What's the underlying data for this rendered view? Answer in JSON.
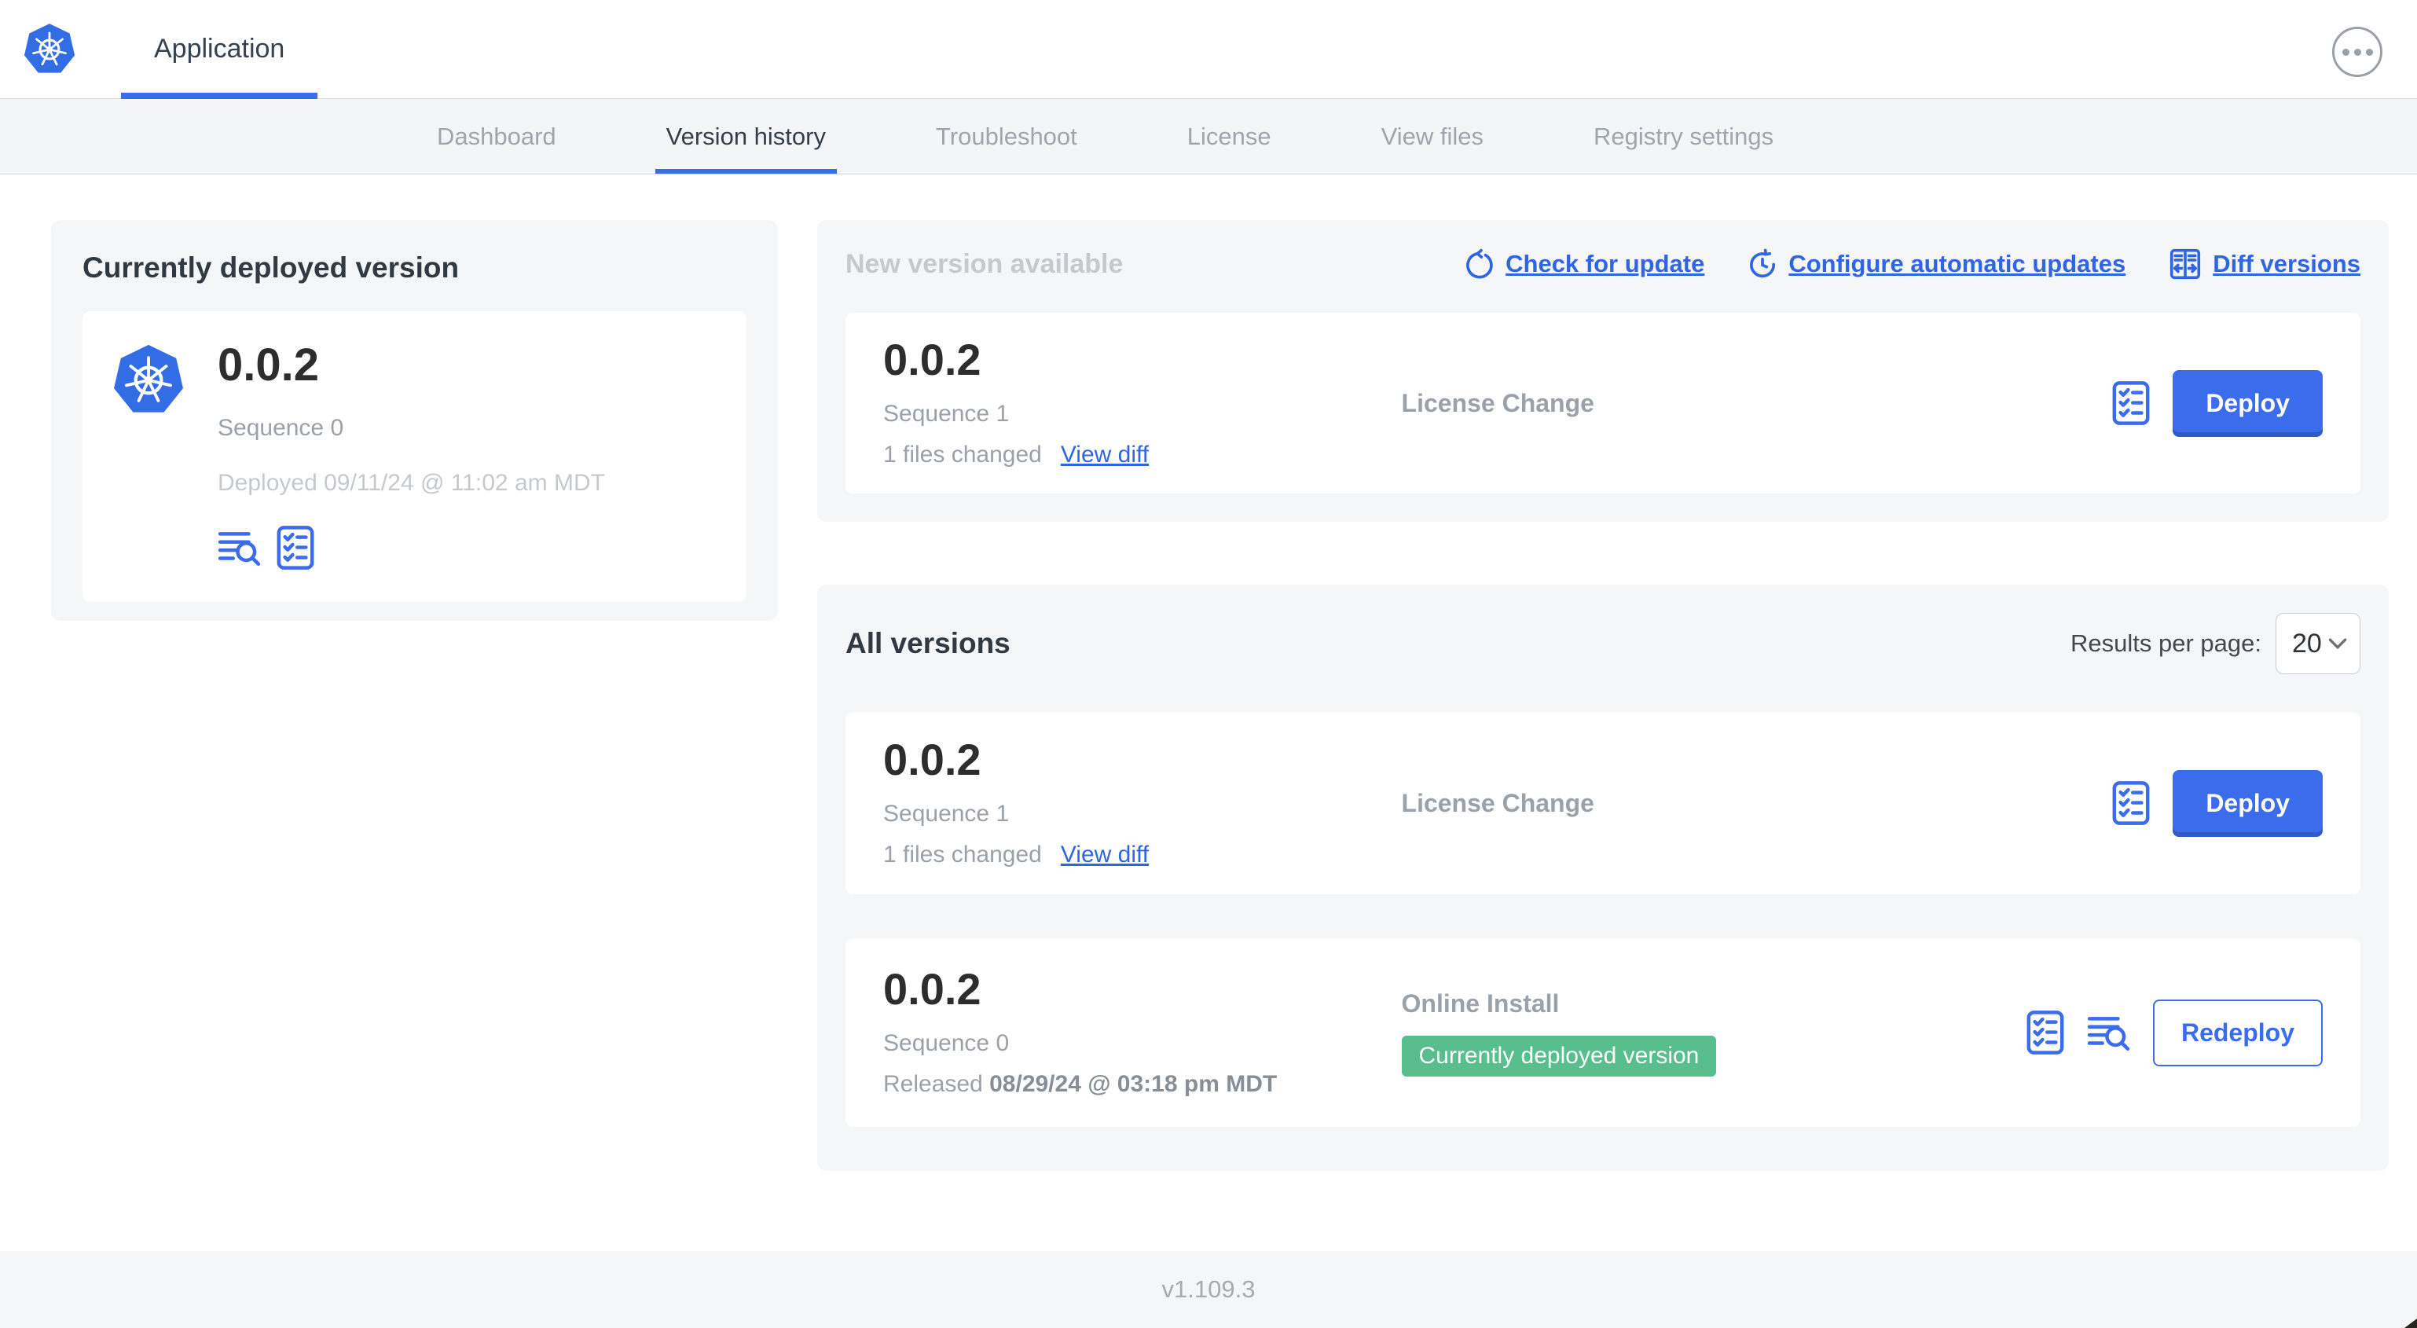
{
  "header": {
    "app_tab_label": "Application"
  },
  "nav_tabs": [
    {
      "label": "Dashboard"
    },
    {
      "label": "Version history"
    },
    {
      "label": "Troubleshoot"
    },
    {
      "label": "License"
    },
    {
      "label": "View files"
    },
    {
      "label": "Registry settings"
    }
  ],
  "current_version": {
    "title": "Currently deployed version",
    "version": "0.0.2",
    "sequence": "Sequence 0",
    "deployed": "Deployed 09/11/24 @ 11:02 am MDT"
  },
  "new_version": {
    "title": "New version available",
    "actions": [
      {
        "label": "Check for update",
        "icon": "refresh-icon"
      },
      {
        "label": "Configure automatic updates",
        "icon": "clock-refresh-icon"
      },
      {
        "label": "Diff versions",
        "icon": "diff-icon"
      }
    ],
    "row": {
      "version": "0.0.2",
      "sequence": "Sequence 1",
      "files_changed": "1 files changed",
      "view_diff_label": "View diff",
      "source": "License Change",
      "deploy_label": "Deploy"
    }
  },
  "all_versions": {
    "title": "All versions",
    "results_per_page_label": "Results per page:",
    "results_per_page_value": "20",
    "rows": [
      {
        "version": "0.0.2",
        "sequence": "Sequence 1",
        "files_changed": "1 files changed",
        "view_diff_label": "View diff",
        "source": "License Change",
        "action_label": "Deploy"
      },
      {
        "version": "0.0.2",
        "sequence": "Sequence 0",
        "released_prefix": "Released",
        "released_date": "08/29/24 @ 03:18 pm MDT",
        "source": "Online Install",
        "badge": "Currently deployed version",
        "action_label": "Redeploy"
      }
    ]
  },
  "footer": {
    "version_label": "v1.109.3"
  },
  "colors": {
    "primary_blue": "#3b6cec",
    "link_blue": "#3065e0",
    "badge_green": "#57be8c",
    "card_gray": "#f5f6f8"
  }
}
